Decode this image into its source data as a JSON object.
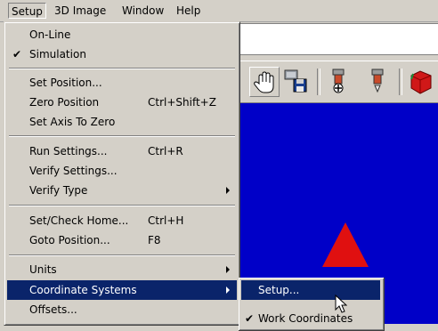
{
  "menubar": {
    "items": [
      {
        "label": "Setup"
      },
      {
        "label": "3D Image"
      },
      {
        "label": "Window"
      },
      {
        "label": "Help"
      }
    ]
  },
  "setup_menu": {
    "items": [
      {
        "label": "On-Line",
        "shortcut": "",
        "checked": false
      },
      {
        "label": "Simulation",
        "shortcut": "",
        "checked": true
      },
      {
        "label": "Set Position...",
        "shortcut": ""
      },
      {
        "label": "Zero Position",
        "shortcut": "Ctrl+Shift+Z"
      },
      {
        "label": "Set Axis To Zero",
        "shortcut": ""
      },
      {
        "label": "Run Settings...",
        "shortcut": "Ctrl+R"
      },
      {
        "label": "Verify Settings...",
        "shortcut": ""
      },
      {
        "label": "Verify Type",
        "shortcut": ""
      },
      {
        "label": "Set/Check Home...",
        "shortcut": "Ctrl+H"
      },
      {
        "label": "Goto Position...",
        "shortcut": "F8"
      },
      {
        "label": "Units",
        "shortcut": ""
      },
      {
        "label": "Coordinate Systems",
        "shortcut": ""
      },
      {
        "label": "Offsets...",
        "shortcut": ""
      }
    ],
    "check_glyph": "✔"
  },
  "coordinate_submenu": {
    "items": [
      {
        "label": "Setup..."
      },
      {
        "label": "Work Coordinates"
      }
    ]
  },
  "toolbar": {
    "icons": [
      "hand-pan-icon",
      "save-machine-icon",
      "tool-probe-icon",
      "tool-home-icon",
      "red-cube-icon"
    ]
  },
  "colors": {
    "highlight": "#0a246a",
    "viewport": "#0000c8",
    "marker": "#e01010",
    "menu_bg": "#d4d0c8"
  }
}
